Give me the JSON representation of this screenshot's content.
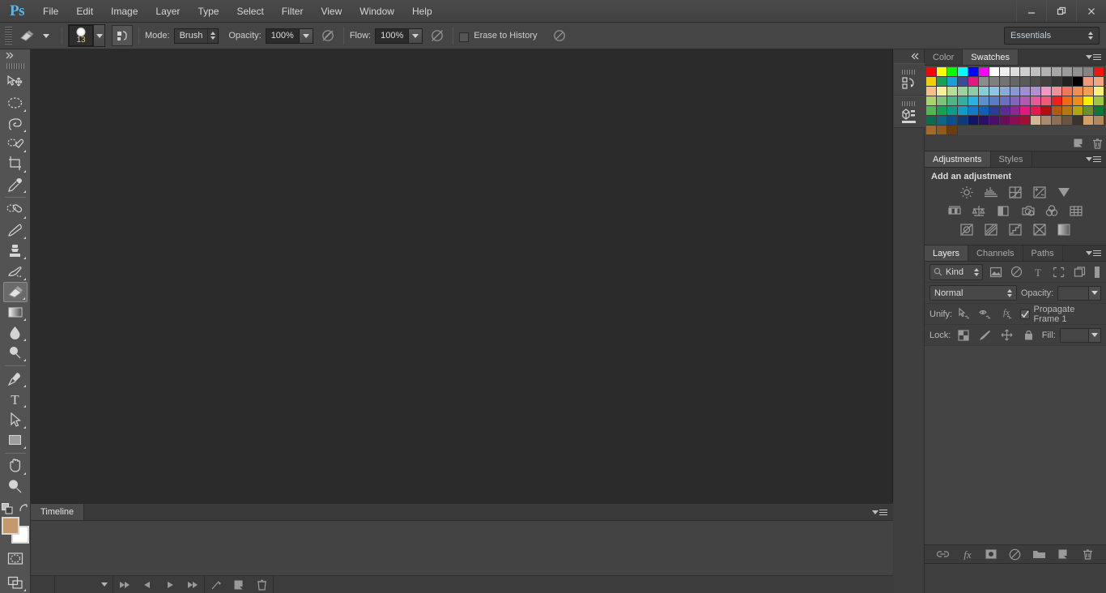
{
  "app": {
    "logo": "Ps",
    "title": "Adobe Photoshop"
  },
  "menubar": {
    "items": [
      {
        "label": "File"
      },
      {
        "label": "Edit"
      },
      {
        "label": "Image"
      },
      {
        "label": "Layer"
      },
      {
        "label": "Type"
      },
      {
        "label": "Select"
      },
      {
        "label": "Filter"
      },
      {
        "label": "View"
      },
      {
        "label": "Window"
      },
      {
        "label": "Help"
      }
    ]
  },
  "window_controls": {
    "minimize": "minimize-icon",
    "restore": "restore-icon",
    "close": "close-icon"
  },
  "options_bar": {
    "tool_icon": "eraser-icon",
    "tool_preset_arrow": "chevron-down-icon",
    "brush_size": "13",
    "brush_panel_icon": "brush-panel-icon",
    "mode_label": "Mode:",
    "mode_value": "Brush",
    "opacity_label": "Opacity:",
    "opacity_value": "100%",
    "opacity_pressure_icon": "pressure-opacity-icon",
    "flow_label": "Flow:",
    "flow_value": "100%",
    "airbrush_icon": "airbrush-icon",
    "erase_to_history_label": "Erase to History",
    "erase_to_history_checked": false,
    "pressure_size_icon": "pressure-size-icon",
    "workspace": "Essentials"
  },
  "toolbar": {
    "collapse_icon": "collapse-left-icon",
    "tools": [
      {
        "name": "move-tool",
        "icon": "move-icon",
        "has_corner": false,
        "active": false
      },
      {
        "name": "marquee-tool",
        "icon": "elliptical-marquee-icon",
        "has_corner": true,
        "active": false
      },
      {
        "name": "lasso-tool",
        "icon": "lasso-icon",
        "has_corner": true,
        "active": false
      },
      {
        "name": "quick-selection-tool",
        "icon": "quick-selection-icon",
        "has_corner": true,
        "active": false
      },
      {
        "name": "crop-tool",
        "icon": "crop-icon",
        "has_corner": true,
        "active": false
      },
      {
        "name": "eyedropper-tool",
        "icon": "eyedropper-icon",
        "has_corner": true,
        "active": false
      },
      {
        "name": "healing-brush-tool",
        "icon": "healing-brush-icon",
        "has_corner": true,
        "active": false
      },
      {
        "name": "brush-tool",
        "icon": "brush-icon",
        "has_corner": true,
        "active": false
      },
      {
        "name": "clone-stamp-tool",
        "icon": "clone-stamp-icon",
        "has_corner": true,
        "active": false
      },
      {
        "name": "history-brush-tool",
        "icon": "history-brush-icon",
        "has_corner": true,
        "active": false
      },
      {
        "name": "eraser-tool",
        "icon": "eraser-icon",
        "has_corner": true,
        "active": true
      },
      {
        "name": "gradient-tool",
        "icon": "gradient-icon",
        "has_corner": true,
        "active": false
      },
      {
        "name": "blur-tool",
        "icon": "blur-drop-icon",
        "has_corner": true,
        "active": false
      },
      {
        "name": "dodge-tool",
        "icon": "dodge-icon",
        "has_corner": true,
        "active": false
      },
      {
        "name": "pen-tool",
        "icon": "pen-icon",
        "has_corner": true,
        "active": false
      },
      {
        "name": "type-tool",
        "icon": "type-icon",
        "has_corner": true,
        "active": false
      },
      {
        "name": "path-selection-tool",
        "icon": "path-selection-icon",
        "has_corner": true,
        "active": false
      },
      {
        "name": "rectangle-tool",
        "icon": "rectangle-icon",
        "has_corner": true,
        "active": false
      },
      {
        "name": "hand-tool",
        "icon": "hand-icon",
        "has_corner": true,
        "active": false
      },
      {
        "name": "zoom-tool",
        "icon": "zoom-icon",
        "has_corner": false,
        "active": false
      }
    ],
    "default_colors_icon": "default-colors-icon",
    "swap_colors_icon": "swap-colors-icon",
    "foreground_color": "#c49a6c",
    "background_color": "#ffffff",
    "quick_mask_icon": "quick-mask-icon",
    "screen_mode_icon": "screen-mode-icon"
  },
  "dock_strip": {
    "collapse_icon": "collapse-right-icon",
    "icons": [
      {
        "name": "history-panel-icon"
      },
      {
        "name": "properties-panel-icon"
      }
    ]
  },
  "swatches_panel": {
    "tabs": [
      {
        "label": "Color",
        "active": false
      },
      {
        "label": "Swatches",
        "active": true
      }
    ],
    "menu_icon": "panel-menu-icon",
    "new_swatch_icon": "new-swatch-icon",
    "delete_swatch_icon": "trash-icon",
    "colors": [
      "#ff0000",
      "#ffff00",
      "#00ff00",
      "#00ffff",
      "#0000ff",
      "#ff00ff",
      "#ffffff",
      "#efefef",
      "#dddddd",
      "#cfcfcf",
      "#c0c0c0",
      "#b2b2b2",
      "#a6a6a6",
      "#9b9b9b",
      "#909090",
      "#858585",
      "#f01414",
      "#f0d000",
      "#16a05a",
      "#1a9fd8",
      "#3c4a9a",
      "#e6187d",
      "#8c8c8c",
      "#7f7f7f",
      "#737373",
      "#666666",
      "#5a5a5a",
      "#4e4e4e",
      "#414141",
      "#343434",
      "#222222",
      "#000000",
      "#f09878",
      "#f0a884",
      "#f5c08c",
      "#f7ef9c",
      "#b7dc9c",
      "#9cd2a0",
      "#8ccaa8",
      "#84cfd4",
      "#8cc4e8",
      "#8ca8de",
      "#8c96d4",
      "#9f8fd0",
      "#b48fd0",
      "#f098c0",
      "#f0909c",
      "#f07858",
      "#f09050",
      "#f0a050",
      "#f7f07a",
      "#a8d46a",
      "#7cc278",
      "#50b486",
      "#34ae9e",
      "#2eaee2",
      "#5a8fd0",
      "#5a7cc4",
      "#6a6fc0",
      "#8464b8",
      "#b05ab0",
      "#e65a9c",
      "#f05a78",
      "#f01e1e",
      "#f06a16",
      "#f08c14",
      "#f5f000",
      "#9ec642",
      "#56b454",
      "#16a050",
      "#0e9c86",
      "#0f9cc4",
      "#1878c4",
      "#1060b4",
      "#2a3c96",
      "#5a2c96",
      "#8c2896",
      "#e6187d",
      "#e61850",
      "#b40e14",
      "#b45a0e",
      "#b4780e",
      "#b4a40e",
      "#6a9030",
      "#0e7838",
      "#0e6a50",
      "#0e6484",
      "#0e4e8c",
      "#0e3a7c",
      "#141466",
      "#2a0e6a",
      "#4a0e6a",
      "#6a0e5a",
      "#8c0e50",
      "#a00e32",
      "#d4b896",
      "#a88c72",
      "#8c7056",
      "#6a5442",
      "#3c3230",
      "#d4a068",
      "#b4885a",
      "#a06a2c",
      "#8c5a22",
      "#6a3c14"
    ]
  },
  "adjustments_panel": {
    "tabs": [
      {
        "label": "Adjustments",
        "active": true
      },
      {
        "label": "Styles",
        "active": false
      }
    ],
    "menu_icon": "panel-menu-icon",
    "title": "Add an adjustment",
    "rows": [
      [
        {
          "name": "brightness-contrast-adjustment"
        },
        {
          "name": "levels-adjustment"
        },
        {
          "name": "curves-adjustment"
        },
        {
          "name": "exposure-adjustment"
        },
        {
          "name": "vibrance-adjustment"
        }
      ],
      [
        {
          "name": "hue-saturation-adjustment"
        },
        {
          "name": "color-balance-adjustment"
        },
        {
          "name": "black-white-adjustment"
        },
        {
          "name": "photo-filter-adjustment"
        },
        {
          "name": "channel-mixer-adjustment"
        },
        {
          "name": "color-lookup-adjustment"
        }
      ],
      [
        {
          "name": "invert-adjustment"
        },
        {
          "name": "posterize-adjustment"
        },
        {
          "name": "threshold-adjustment"
        },
        {
          "name": "selective-color-adjustment"
        },
        {
          "name": "gradient-map-adjustment"
        }
      ]
    ]
  },
  "layers_panel": {
    "tabs": [
      {
        "label": "Layers",
        "active": true
      },
      {
        "label": "Channels",
        "active": false
      },
      {
        "label": "Paths",
        "active": false
      }
    ],
    "menu_icon": "panel-menu-icon",
    "filter": {
      "search_icon": "search-icon",
      "kind_label": "Kind",
      "icons": [
        {
          "name": "filter-pixel-layers-icon"
        },
        {
          "name": "filter-adjustment-layers-icon"
        },
        {
          "name": "filter-type-layers-icon"
        },
        {
          "name": "filter-shape-layers-icon"
        },
        {
          "name": "filter-smart-object-icon"
        }
      ],
      "toggle_icon": "filter-toggle-icon"
    },
    "blend_mode": "Normal",
    "opacity_label": "Opacity:",
    "opacity_value": "",
    "unify_label": "Unify:",
    "unify_icons": [
      {
        "name": "unify-position-icon"
      },
      {
        "name": "unify-visibility-icon"
      },
      {
        "name": "unify-style-icon"
      }
    ],
    "propagate_label": "Propagate Frame 1",
    "propagate_checked": true,
    "lock_label": "Lock:",
    "lock_icons": [
      {
        "name": "lock-transparent-pixels-icon"
      },
      {
        "name": "lock-image-pixels-icon"
      },
      {
        "name": "lock-position-icon"
      },
      {
        "name": "lock-all-icon"
      }
    ],
    "fill_label": "Fill:",
    "fill_value": "",
    "footer_icons": [
      {
        "name": "link-layers-icon"
      },
      {
        "name": "layer-style-fx-icon"
      },
      {
        "name": "add-layer-mask-icon"
      },
      {
        "name": "new-adjustment-layer-icon"
      },
      {
        "name": "new-group-icon"
      },
      {
        "name": "new-layer-icon"
      },
      {
        "name": "delete-layer-icon"
      }
    ]
  },
  "timeline_panel": {
    "tabs": [
      {
        "label": "Timeline",
        "active": true
      }
    ],
    "menu_icon": "panel-menu-icon",
    "controls": [
      {
        "name": "loop-options-dropdown",
        "icon": "chevron-down-icon"
      },
      {
        "name": "select-first-frame-button",
        "icon": "rewind-icon"
      },
      {
        "name": "select-previous-frame-button",
        "icon": "previous-icon"
      },
      {
        "name": "play-animation-button",
        "icon": "play-icon"
      },
      {
        "name": "select-next-frame-button",
        "icon": "forward-icon"
      },
      {
        "name": "tween-frames-button",
        "icon": "tween-icon"
      },
      {
        "name": "duplicate-frame-button",
        "icon": "duplicate-icon"
      },
      {
        "name": "delete-frame-button",
        "icon": "trash-icon"
      }
    ]
  }
}
